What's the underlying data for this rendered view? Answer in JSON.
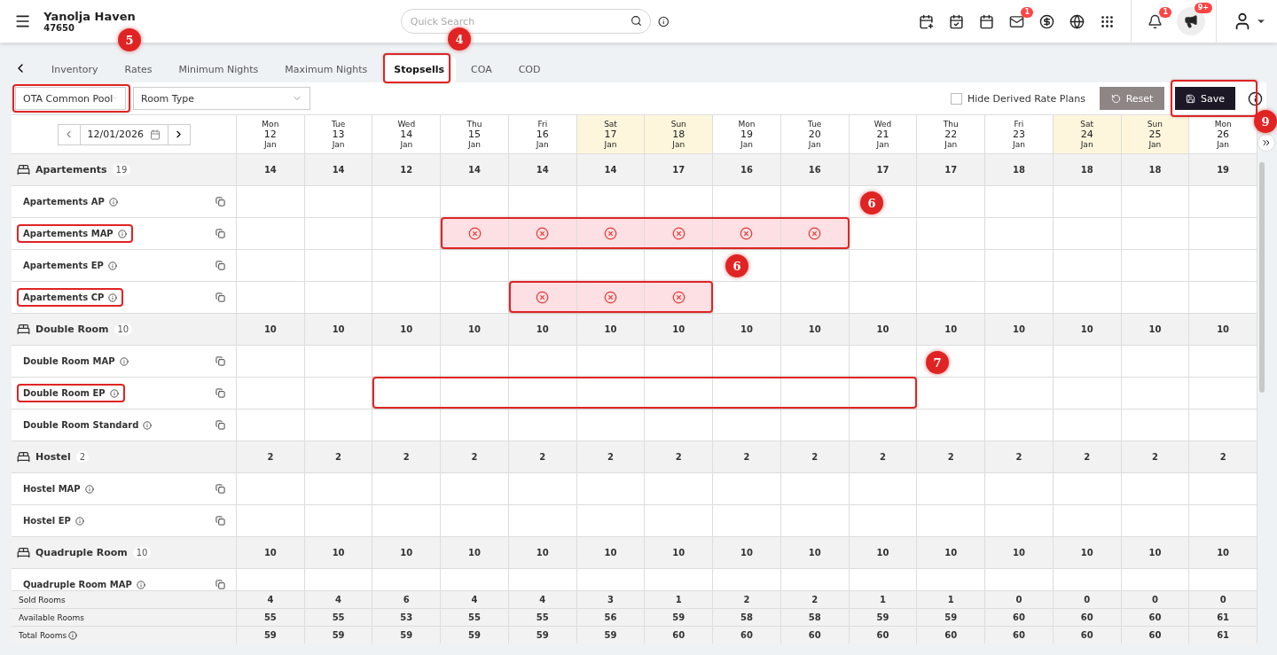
{
  "header": {
    "brand": "Yanolja Haven",
    "property_id": "47650",
    "search": {
      "placeholder": "Quick Search"
    },
    "badges": {
      "mail": "1",
      "notifications": "1",
      "announcements": "9+"
    }
  },
  "tabs": [
    {
      "label": "Inventory",
      "selected": false
    },
    {
      "label": "Rates",
      "selected": false
    },
    {
      "label": "Minimum Nights",
      "selected": false
    },
    {
      "label": "Maximum Nights",
      "selected": false
    },
    {
      "label": "Stopsells",
      "selected": true
    },
    {
      "label": "COA",
      "selected": false
    },
    {
      "label": "COD",
      "selected": false
    }
  ],
  "toolbar": {
    "channel": "OTA Common Pool",
    "room_type": {
      "placeholder": "Room Type"
    },
    "hide_derived": {
      "label": "Hide Derived Rate Plans",
      "checked": false
    },
    "reset": "Reset",
    "save": "Save"
  },
  "date_picker": {
    "value": "12/01/2026"
  },
  "days": [
    {
      "dow": "Mon",
      "day": "12",
      "month": "Jan",
      "weekend": false
    },
    {
      "dow": "Tue",
      "day": "13",
      "month": "Jan",
      "weekend": false
    },
    {
      "dow": "Wed",
      "day": "14",
      "month": "Jan",
      "weekend": false
    },
    {
      "dow": "Thu",
      "day": "15",
      "month": "Jan",
      "weekend": false
    },
    {
      "dow": "Fri",
      "day": "16",
      "month": "Jan",
      "weekend": false
    },
    {
      "dow": "Sat",
      "day": "17",
      "month": "Jan",
      "weekend": true
    },
    {
      "dow": "Sun",
      "day": "18",
      "month": "Jan",
      "weekend": true
    },
    {
      "dow": "Mon",
      "day": "19",
      "month": "Jan",
      "weekend": false
    },
    {
      "dow": "Tue",
      "day": "20",
      "month": "Jan",
      "weekend": false
    },
    {
      "dow": "Wed",
      "day": "21",
      "month": "Jan",
      "weekend": false
    },
    {
      "dow": "Thu",
      "day": "22",
      "month": "Jan",
      "weekend": false
    },
    {
      "dow": "Fri",
      "day": "23",
      "month": "Jan",
      "weekend": false
    },
    {
      "dow": "Sat",
      "day": "24",
      "month": "Jan",
      "weekend": true
    },
    {
      "dow": "Sun",
      "day": "25",
      "month": "Jan",
      "weekend": true
    },
    {
      "dow": "Mon",
      "day": "26",
      "month": "Jan",
      "weekend": false
    }
  ],
  "room_groups": [
    {
      "name": "Apartements",
      "count": "19",
      "values": [
        "14",
        "14",
        "12",
        "14",
        "14",
        "14",
        "17",
        "16",
        "16",
        "17",
        "17",
        "18",
        "18",
        "18",
        "19"
      ],
      "plans": [
        {
          "name": "Apartements AP",
          "outlined": false,
          "stopped": [
            false,
            false,
            false,
            false,
            false,
            false,
            false,
            false,
            false,
            false,
            false,
            false,
            false,
            false,
            false
          ]
        },
        {
          "name": "Apartements MAP",
          "outlined": true,
          "stopped": [
            false,
            false,
            false,
            true,
            true,
            true,
            true,
            true,
            true,
            false,
            false,
            false,
            false,
            false,
            false
          ]
        },
        {
          "name": "Apartements EP",
          "outlined": false,
          "stopped": [
            false,
            false,
            false,
            false,
            false,
            false,
            false,
            false,
            false,
            false,
            false,
            false,
            false,
            false,
            false
          ]
        },
        {
          "name": "Apartements CP",
          "outlined": true,
          "stopped": [
            false,
            false,
            false,
            false,
            true,
            true,
            true,
            false,
            false,
            false,
            false,
            false,
            false,
            false,
            false
          ]
        }
      ]
    },
    {
      "name": "Double Room",
      "count": "10",
      "values": [
        "10",
        "10",
        "10",
        "10",
        "10",
        "10",
        "10",
        "10",
        "10",
        "10",
        "10",
        "10",
        "10",
        "10",
        "10"
      ],
      "plans": [
        {
          "name": "Double Room MAP",
          "outlined": false,
          "stopped": [
            false,
            false,
            false,
            false,
            false,
            false,
            false,
            false,
            false,
            false,
            false,
            false,
            false,
            false,
            false
          ]
        },
        {
          "name": "Double Room EP",
          "outlined": true,
          "stopped": [
            false,
            false,
            false,
            false,
            false,
            false,
            false,
            false,
            false,
            false,
            false,
            false,
            false,
            false,
            false
          ]
        },
        {
          "name": "Double Room Standard",
          "outlined": false,
          "stopped": [
            false,
            false,
            false,
            false,
            false,
            false,
            false,
            false,
            false,
            false,
            false,
            false,
            false,
            false,
            false
          ]
        }
      ]
    },
    {
      "name": "Hostel",
      "count": "2",
      "values": [
        "2",
        "2",
        "2",
        "2",
        "2",
        "2",
        "2",
        "2",
        "2",
        "2",
        "2",
        "2",
        "2",
        "2",
        "2"
      ],
      "plans": [
        {
          "name": "Hostel MAP",
          "outlined": false,
          "stopped": [
            false,
            false,
            false,
            false,
            false,
            false,
            false,
            false,
            false,
            false,
            false,
            false,
            false,
            false,
            false
          ]
        },
        {
          "name": "Hostel EP",
          "outlined": false,
          "stopped": [
            false,
            false,
            false,
            false,
            false,
            false,
            false,
            false,
            false,
            false,
            false,
            false,
            false,
            false,
            false
          ]
        }
      ]
    },
    {
      "name": "Quadruple Room",
      "count": "10",
      "values": [
        "10",
        "10",
        "10",
        "10",
        "10",
        "10",
        "10",
        "10",
        "10",
        "10",
        "10",
        "10",
        "10",
        "10",
        "10"
      ],
      "plans": [
        {
          "name": "Quadruple Room MAP",
          "outlined": false,
          "stopped": [
            false,
            false,
            false,
            false,
            false,
            false,
            false,
            false,
            false,
            false,
            false,
            false,
            false,
            false,
            false
          ]
        }
      ]
    }
  ],
  "summary": [
    {
      "label": "Sold Rooms",
      "info": false,
      "values": [
        "4",
        "4",
        "6",
        "4",
        "4",
        "3",
        "1",
        "2",
        "2",
        "1",
        "1",
        "0",
        "0",
        "0",
        "0"
      ]
    },
    {
      "label": "Available Rooms",
      "info": false,
      "values": [
        "55",
        "55",
        "53",
        "55",
        "55",
        "56",
        "59",
        "58",
        "58",
        "59",
        "59",
        "60",
        "60",
        "60",
        "61"
      ]
    },
    {
      "label": "Total Rooms",
      "info": true,
      "values": [
        "59",
        "59",
        "59",
        "59",
        "59",
        "59",
        "60",
        "60",
        "60",
        "60",
        "60",
        "60",
        "60",
        "60",
        "61"
      ]
    }
  ],
  "annotations": [
    {
      "kind": "frame"
    },
    {
      "kind": "marker",
      "label": "4"
    },
    {
      "kind": "frame"
    },
    {
      "kind": "marker",
      "label": "5"
    },
    {
      "kind": "frame"
    },
    {
      "kind": "marker",
      "label": "9"
    },
    {
      "kind": "frame"
    },
    {
      "kind": "marker",
      "label": "6"
    },
    {
      "kind": "frame"
    },
    {
      "kind": "marker",
      "label": "6"
    },
    {
      "kind": "frame"
    },
    {
      "kind": "marker",
      "label": "7"
    }
  ]
}
